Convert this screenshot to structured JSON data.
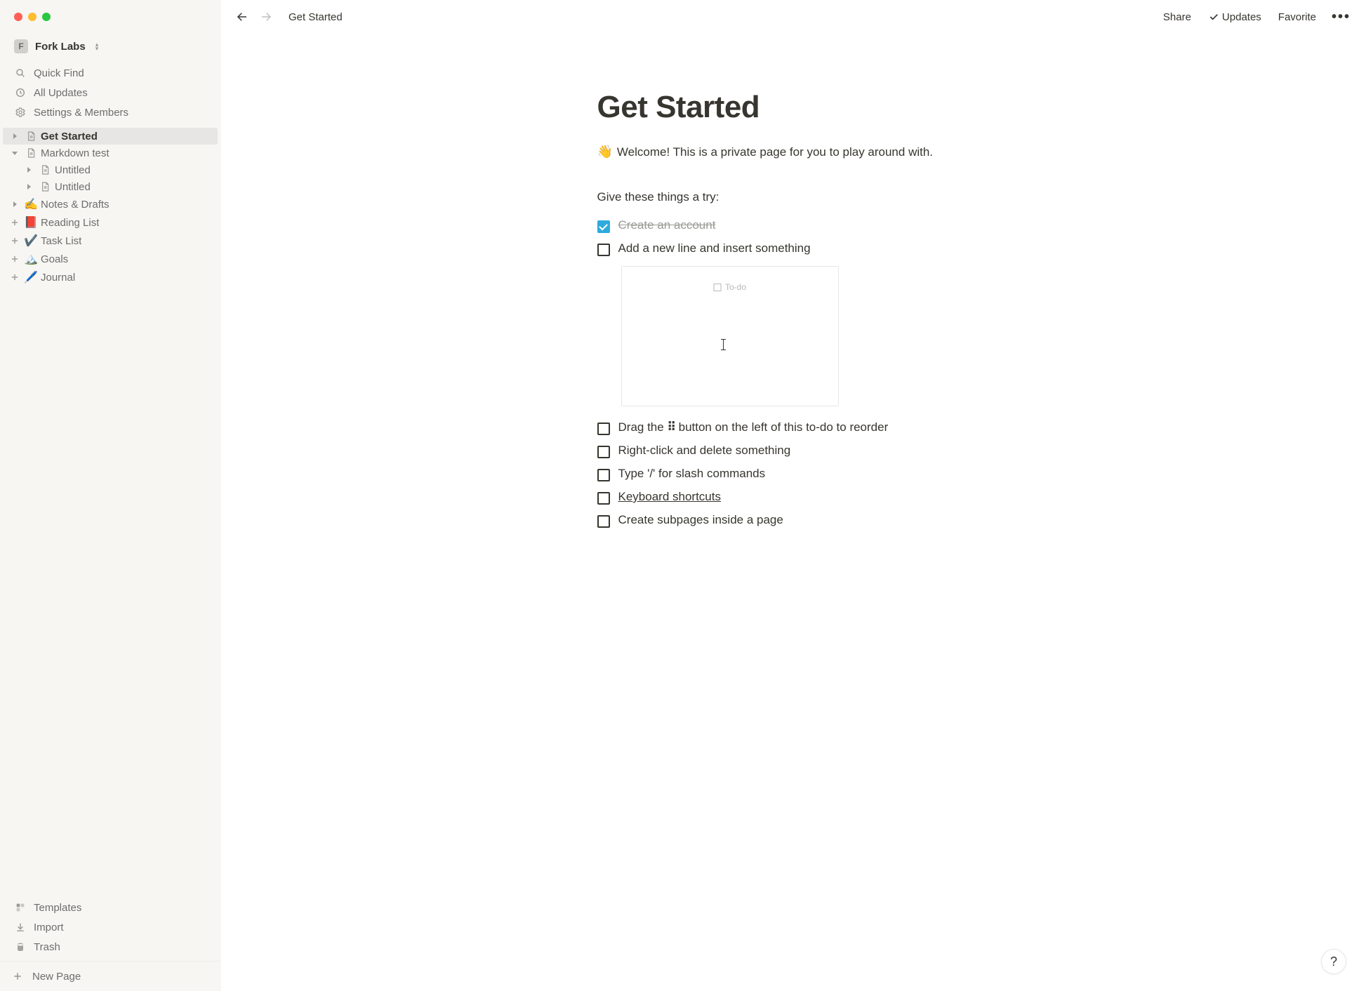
{
  "workspace": {
    "initial": "F",
    "name": "Fork Labs"
  },
  "sidebar_nav": {
    "quick_find": "Quick Find",
    "all_updates": "All Updates",
    "settings": "Settings & Members"
  },
  "pages": [
    {
      "label": "Get Started",
      "icon": "page",
      "toggle": "collapsed",
      "active": true,
      "indent": 0
    },
    {
      "label": "Markdown test",
      "icon": "page",
      "toggle": "expanded",
      "active": false,
      "indent": 0
    },
    {
      "label": "Untitled",
      "icon": "page",
      "toggle": "collapsed",
      "active": false,
      "indent": 1
    },
    {
      "label": "Untitled",
      "icon": "page",
      "toggle": "collapsed",
      "active": false,
      "indent": 1
    },
    {
      "label": "Notes & Drafts",
      "icon": "✍️",
      "toggle": "collapsed",
      "active": false,
      "indent": 0
    },
    {
      "label": "Reading List",
      "icon": "📕",
      "toggle": "plus",
      "active": false,
      "indent": 0
    },
    {
      "label": "Task List",
      "icon": "✔️",
      "toggle": "plus",
      "active": false,
      "indent": 0
    },
    {
      "label": "Goals",
      "icon": "🏔️",
      "toggle": "plus",
      "active": false,
      "indent": 0
    },
    {
      "label": "Journal",
      "icon": "🖊️",
      "toggle": "plus",
      "active": false,
      "indent": 0
    }
  ],
  "sidebar_utility": {
    "templates": "Templates",
    "import": "Import",
    "trash": "Trash"
  },
  "new_page_label": "New Page",
  "topbar": {
    "breadcrumb": "Get Started",
    "share": "Share",
    "updates": "Updates",
    "favorite": "Favorite"
  },
  "content": {
    "title": "Get Started",
    "welcome_emoji": "👋",
    "welcome_text": "Welcome! This is a private page for you to play around with.",
    "try_heading": "Give these things a try:",
    "todos": [
      {
        "text": "Create an account",
        "checked": true
      },
      {
        "text": "Add a new line and insert something",
        "checked": false
      },
      {
        "text_pre": "Drag the ",
        "text_mid": "⠿",
        "text_post": " button on the left of this to-do to reorder",
        "checked": false,
        "drag": true
      },
      {
        "text": "Right-click and delete something",
        "checked": false
      },
      {
        "text": "Type '/' for slash commands",
        "checked": false
      },
      {
        "text": "Keyboard shortcuts",
        "checked": false,
        "link": true
      },
      {
        "text": "Create subpages inside a page",
        "checked": false
      }
    ],
    "embed_placeholder": "To-do"
  },
  "help_label": "?"
}
